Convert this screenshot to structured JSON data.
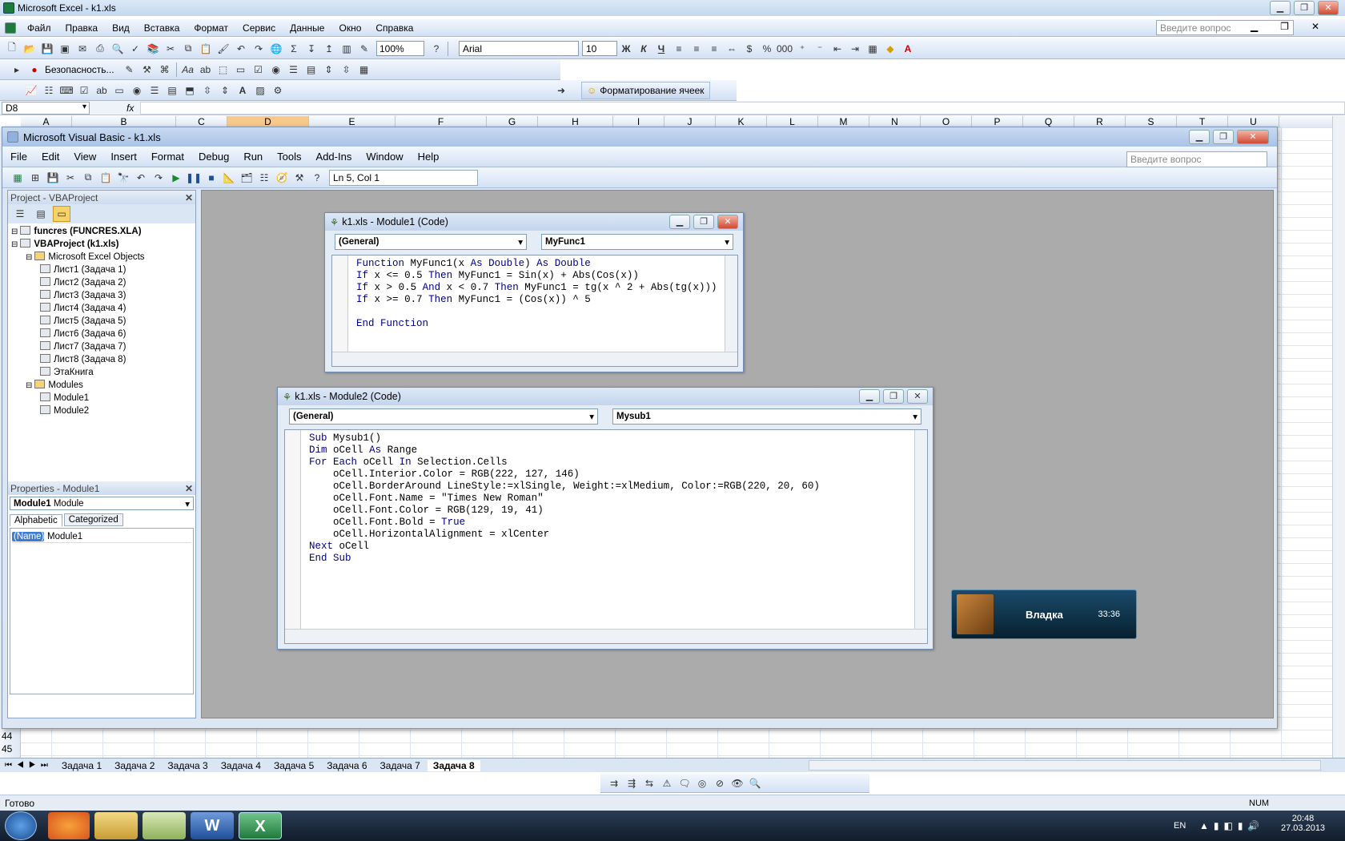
{
  "excel": {
    "title": "Microsoft Excel - k1.xls",
    "menu": [
      "Файл",
      "Правка",
      "Вид",
      "Вставка",
      "Формат",
      "Сервис",
      "Данные",
      "Окно",
      "Справка"
    ],
    "help_placeholder": "Введите вопрос",
    "zoom": "100%",
    "font_name": "Arial",
    "font_size": "10",
    "bold_label": "Ж",
    "italic_label": "К",
    "underline_label": "Ч",
    "security_label": "Безопасность...",
    "format_cells_label": "Форматирование ячеек",
    "name_box": "D8",
    "fx": "fx",
    "columns": [
      "A",
      "B",
      "C",
      "D",
      "E",
      "F",
      "G",
      "H",
      "I",
      "J",
      "K",
      "L",
      "M",
      "N",
      "O",
      "P",
      "Q",
      "R",
      "S",
      "T",
      "U"
    ],
    "row_numbers": [
      "44",
      "45"
    ],
    "sheet_tabs": [
      "Задача 1",
      "Задача 2",
      "Задача 3",
      "Задача 4",
      "Задача 5",
      "Задача 6",
      "Задача 7",
      "Задача 8"
    ],
    "active_sheet": "Задача 8",
    "status": "Готово",
    "num": "NUM"
  },
  "vbe": {
    "title": "Microsoft Visual Basic - k1.xls",
    "menu": [
      "File",
      "Edit",
      "View",
      "Insert",
      "Format",
      "Debug",
      "Run",
      "Tools",
      "Add-Ins",
      "Window",
      "Help"
    ],
    "help_placeholder": "Введите вопрос",
    "cursor_pos": "Ln 5, Col 1",
    "project_title": "Project - VBAProject",
    "tree": [
      {
        "label": "funcres (FUNCRES.XLA)",
        "indent": 0,
        "bold": true
      },
      {
        "label": "VBAProject (k1.xls)",
        "indent": 0,
        "bold": true
      },
      {
        "label": "Microsoft Excel Objects",
        "indent": 1,
        "bold": false
      },
      {
        "label": "Лист1 (Задача 1)",
        "indent": 2,
        "bold": false
      },
      {
        "label": "Лист2 (Задача 2)",
        "indent": 2,
        "bold": false
      },
      {
        "label": "Лист3 (Задача 3)",
        "indent": 2,
        "bold": false
      },
      {
        "label": "Лист4 (Задача 4)",
        "indent": 2,
        "bold": false
      },
      {
        "label": "Лист5 (Задача 5)",
        "indent": 2,
        "bold": false
      },
      {
        "label": "Лист6 (Задача 6)",
        "indent": 2,
        "bold": false
      },
      {
        "label": "Лист7 (Задача 7)",
        "indent": 2,
        "bold": false
      },
      {
        "label": "Лист8 (Задача 8)",
        "indent": 2,
        "bold": false
      },
      {
        "label": "ЭтаКнига",
        "indent": 2,
        "bold": false
      },
      {
        "label": "Modules",
        "indent": 1,
        "bold": false
      },
      {
        "label": "Module1",
        "indent": 2,
        "bold": false
      },
      {
        "label": "Module2",
        "indent": 2,
        "bold": false
      }
    ],
    "properties_title": "Properties - Module1",
    "props_object": "Module1",
    "props_object_type": "Module",
    "props_tabs": [
      "Alphabetic",
      "Categorized"
    ],
    "prop_name": "(Name)",
    "prop_value": "Module1"
  },
  "module1": {
    "title": "k1.xls - Module1 (Code)",
    "object": "(General)",
    "procedure": "MyFunc1",
    "code": [
      "Function MyFunc1(x As Double) As Double",
      "If x <= 0.5 Then MyFunc1 = Sin(x) + Abs(Cos(x))",
      "If x > 0.5 And x < 0.7 Then MyFunc1 = tg(x ^ 2 + Abs(tg(x)))",
      "If x >= 0.7 Then MyFunc1 = (Cos(x)) ^ 5",
      "",
      "End Function"
    ]
  },
  "module2": {
    "title": "k1.xls - Module2 (Code)",
    "object": "(General)",
    "procedure": "Mysub1",
    "code": [
      "Sub Mysub1()",
      "Dim oCell As Range",
      "For Each oCell In Selection.Cells",
      "    oCell.Interior.Color = RGB(222, 127, 146)",
      "    oCell.BorderAround LineStyle:=xlSingle, Weight:=xlMedium, Color:=RGB(220, 20, 60)",
      "    oCell.Font.Name = \"Times New Roman\"",
      "    oCell.Font.Color = RGB(129, 19, 41)",
      "    oCell.Font.Bold = True",
      "    oCell.HorizontalAlignment = xlCenter",
      "Next oCell",
      "End Sub"
    ]
  },
  "notification": {
    "name": "Владка",
    "time": "33:36"
  },
  "taskbar": {
    "lang": "EN",
    "time": "20:48",
    "date": "27.03.2013"
  },
  "colors": {
    "keyword": "#00008b",
    "vbe_workspace": "#ababab",
    "taskbar": "#1b2a3f"
  }
}
